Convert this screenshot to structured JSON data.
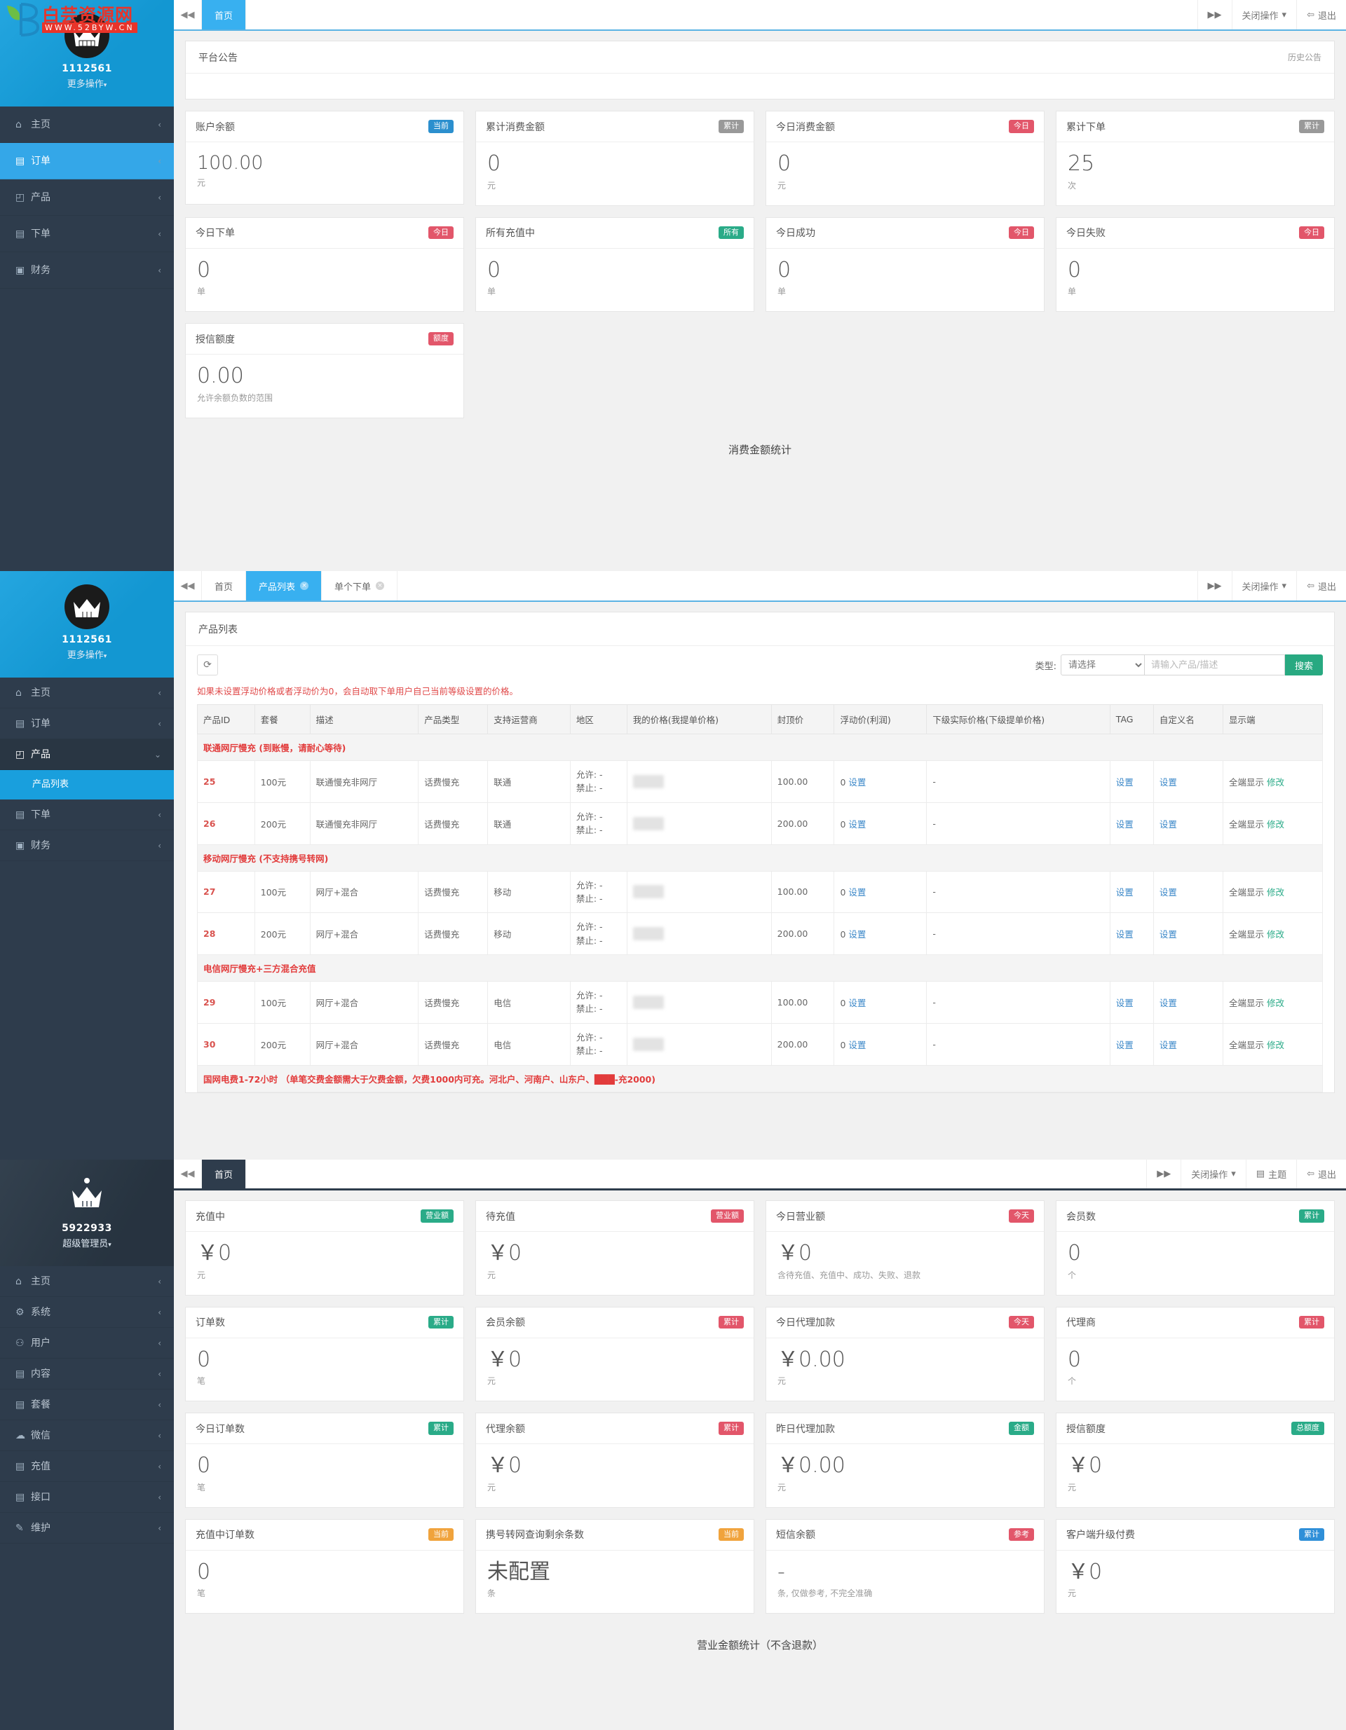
{
  "panel1": {
    "topbar": {
      "collapse_icon": "chevron-double-left-icon",
      "expand_icon": "chevron-double-right-icon",
      "tabs": [
        {
          "label": "首页",
          "active": true,
          "closable": false
        }
      ],
      "actions": [
        {
          "label": "关闭操作",
          "icon": "caret-down-icon"
        },
        {
          "label": "退出",
          "icon": "logout-icon"
        }
      ]
    },
    "sidebar": {
      "user": "1112561",
      "role": "更多操作",
      "avatar_icon": "crown-avatar-icon",
      "items": [
        {
          "label": "主页",
          "icon": "home-icon",
          "active": false
        },
        {
          "label": "订单",
          "icon": "file-icon",
          "active": true
        },
        {
          "label": "产品",
          "icon": "box-icon",
          "active": false
        },
        {
          "label": "下单",
          "icon": "file-icon",
          "active": false
        },
        {
          "label": "财务",
          "icon": "money-icon",
          "active": false
        }
      ]
    },
    "notice": {
      "title": "平台公告",
      "history_link": "历史公告"
    },
    "cards": [
      {
        "title": "账户余额",
        "badge": "当前",
        "badge_color": "blue",
        "value": "100.00",
        "unit": "元"
      },
      {
        "title": "累计消费金额",
        "badge": "累计",
        "badge_color": "gray",
        "value": "0",
        "unit": "元"
      },
      {
        "title": "今日消费金额",
        "badge": "今日",
        "badge_color": "red",
        "value": "0",
        "unit": "元"
      },
      {
        "title": "累计下单",
        "badge": "累计",
        "badge_color": "gray",
        "value": "25",
        "unit": "次"
      },
      {
        "title": "今日下单",
        "badge": "今日",
        "badge_color": "red",
        "value": "0",
        "unit": "单"
      },
      {
        "title": "所有充值中",
        "badge": "所有",
        "badge_color": "green",
        "value": "0",
        "unit": "单"
      },
      {
        "title": "今日成功",
        "badge": "今日",
        "badge_color": "red",
        "value": "0",
        "unit": "单"
      },
      {
        "title": "今日失败",
        "badge": "今日",
        "badge_color": "red",
        "value": "0",
        "unit": "单"
      },
      {
        "title": "授信额度",
        "badge": "额度",
        "badge_color": "red",
        "value": "0.00",
        "unit": "允许余额负数的范围"
      }
    ],
    "chart_title": "消费金额统计"
  },
  "panel2": {
    "topbar": {
      "tabs": [
        {
          "label": "首页",
          "active": false,
          "closable": false
        },
        {
          "label": "产品列表",
          "active": true,
          "closable": true
        },
        {
          "label": "单个下单",
          "active": false,
          "closable": true
        }
      ],
      "actions": [
        {
          "label": "关闭操作",
          "icon": "caret-down-icon"
        },
        {
          "label": "退出",
          "icon": "logout-icon"
        }
      ]
    },
    "sidebar": {
      "user": "1112561",
      "role": "更多操作",
      "avatar_icon": "crown-avatar-icon",
      "items": [
        {
          "label": "主页",
          "icon": "home-icon",
          "active": false
        },
        {
          "label": "订单",
          "icon": "file-icon",
          "active": false
        },
        {
          "label": "产品",
          "icon": "box-icon",
          "active": true,
          "expanded": true
        },
        {
          "label": "下单",
          "icon": "file-icon",
          "active": false
        },
        {
          "label": "财务",
          "icon": "money-icon",
          "active": false
        }
      ],
      "sub_item": "产品列表"
    },
    "panel_title": "产品列表",
    "toolbar": {
      "refresh_icon": "refresh-icon",
      "type_label": "类型:",
      "type_value": "请选择",
      "search_placeholder": "请输入产品/描述",
      "search_button": "搜索"
    },
    "warning": "如果未设置浮动价格或者浮动价为0，会自动取下单用户自己当前等级设置的价格。",
    "table": {
      "headers": [
        "产品ID",
        "套餐",
        "描述",
        "产品类型",
        "支持运营商",
        "地区",
        "我的价格(我提单价格)",
        "封顶价",
        "浮动价(利润)",
        "下级实际价格(下级提单价格)",
        "TAG",
        "自定义名",
        "显示端"
      ],
      "rows": [
        {
          "type": "group",
          "label": "联通网厅慢充 (到账慢，请耐心等待)"
        },
        {
          "type": "row",
          "id": "25",
          "pkg": "100元",
          "desc": "联通慢充非网厅",
          "ptype": "话费慢充",
          "carrier": "联通",
          "region_allow": "允许: -",
          "region_deny": "禁止: -",
          "myprice": "",
          "cap": "100.00",
          "float": "0",
          "float_link": "设置",
          "lower": "-",
          "tag": "设置",
          "custom": "设置",
          "display": "全端显示",
          "edit": "修改"
        },
        {
          "type": "row",
          "id": "26",
          "pkg": "200元",
          "desc": "联通慢充非网厅",
          "ptype": "话费慢充",
          "carrier": "联通",
          "region_allow": "允许: -",
          "region_deny": "禁止: -",
          "myprice": "",
          "cap": "200.00",
          "float": "0",
          "float_link": "设置",
          "lower": "-",
          "tag": "设置",
          "custom": "设置",
          "display": "全端显示",
          "edit": "修改"
        },
        {
          "type": "group",
          "label": "移动网厅慢充 (不支持携号转网)"
        },
        {
          "type": "row",
          "id": "27",
          "pkg": "100元",
          "desc": "网厅+混合",
          "ptype": "话费慢充",
          "carrier": "移动",
          "region_allow": "允许: -",
          "region_deny": "禁止: -",
          "myprice": "",
          "cap": "100.00",
          "float": "0",
          "float_link": "设置",
          "lower": "-",
          "tag": "设置",
          "custom": "设置",
          "display": "全端显示",
          "edit": "修改"
        },
        {
          "type": "row",
          "id": "28",
          "pkg": "200元",
          "desc": "网厅+混合",
          "ptype": "话费慢充",
          "carrier": "移动",
          "region_allow": "允许: -",
          "region_deny": "禁止: -",
          "myprice": "",
          "cap": "200.00",
          "float": "0",
          "float_link": "设置",
          "lower": "-",
          "tag": "设置",
          "custom": "设置",
          "display": "全端显示",
          "edit": "修改"
        },
        {
          "type": "group",
          "label": "电信网厅慢充+三方混合充值"
        },
        {
          "type": "row",
          "id": "29",
          "pkg": "100元",
          "desc": "网厅+混合",
          "ptype": "话费慢充",
          "carrier": "电信",
          "region_allow": "允许: -",
          "region_deny": "禁止: -",
          "myprice": "",
          "cap": "100.00",
          "float": "0",
          "float_link": "设置",
          "lower": "-",
          "tag": "设置",
          "custom": "设置",
          "display": "全端显示",
          "edit": "修改"
        },
        {
          "type": "row",
          "id": "30",
          "pkg": "200元",
          "desc": "网厅+混合",
          "ptype": "话费慢充",
          "carrier": "电信",
          "region_allow": "允许: -",
          "region_deny": "禁止: -",
          "myprice": "",
          "cap": "200.00",
          "float": "0",
          "float_link": "设置",
          "lower": "-",
          "tag": "设置",
          "custom": "设置",
          "display": "全端显示",
          "edit": "修改"
        },
        {
          "type": "group",
          "label": "国网电费1-72小时 （单笔交费金额需大于欠费金额，欠费1000内可充。河北户、河南户、山东户、███-充2000)"
        }
      ]
    }
  },
  "panel3": {
    "topbar": {
      "tabs": [
        {
          "label": "首页",
          "active": true,
          "closable": false
        }
      ],
      "actions": [
        {
          "label": "关闭操作",
          "icon": "caret-down-icon"
        },
        {
          "label": "主题",
          "icon": "theme-icon"
        },
        {
          "label": "退出",
          "icon": "logout-icon"
        }
      ]
    },
    "sidebar": {
      "user": "5922933",
      "role": "超级管理员",
      "avatar_icon": "crown-avatar-icon",
      "items": [
        {
          "label": "主页",
          "icon": "home-icon"
        },
        {
          "label": "系统",
          "icon": "gear-icon"
        },
        {
          "label": "用户",
          "icon": "users-icon"
        },
        {
          "label": "内容",
          "icon": "file-icon"
        },
        {
          "label": "套餐",
          "icon": "file-icon"
        },
        {
          "label": "微信",
          "icon": "wechat-icon"
        },
        {
          "label": "充值",
          "icon": "file-icon"
        },
        {
          "label": "接口",
          "icon": "file-icon"
        },
        {
          "label": "维护",
          "icon": "wrench-icon"
        }
      ]
    },
    "cards": [
      {
        "title": "充值中",
        "badge": "营业额",
        "badge_color": "green",
        "value": "￥0",
        "unit": "元"
      },
      {
        "title": "待充值",
        "badge": "营业额",
        "badge_color": "red",
        "value": "￥0",
        "unit": "元"
      },
      {
        "title": "今日营业额",
        "badge": "今天",
        "badge_color": "red",
        "value": "￥0",
        "unit": "含待充值、充值中、成功、失败、退款"
      },
      {
        "title": "会员数",
        "badge": "累计",
        "badge_color": "green",
        "value": "0",
        "unit": "个"
      },
      {
        "title": "订单数",
        "badge": "累计",
        "badge_color": "green",
        "value": "0",
        "unit": "笔"
      },
      {
        "title": "会员余额",
        "badge": "累计",
        "badge_color": "red",
        "value": "￥0",
        "unit": "元"
      },
      {
        "title": "今日代理加款",
        "badge": "今天",
        "badge_color": "red",
        "value": "￥0.00",
        "unit": "元"
      },
      {
        "title": "代理商",
        "badge": "累计",
        "badge_color": "red",
        "value": "0",
        "unit": "个"
      },
      {
        "title": "今日订单数",
        "badge": "累计",
        "badge_color": "green",
        "value": "0",
        "unit": "笔"
      },
      {
        "title": "代理余额",
        "badge": "累计",
        "badge_color": "red",
        "value": "￥0",
        "unit": "元"
      },
      {
        "title": "昨日代理加款",
        "badge": "金额",
        "badge_color": "green",
        "value": "￥0.00",
        "unit": "元"
      },
      {
        "title": "授信额度",
        "badge": "总额度",
        "badge_color": "green",
        "value": "￥0",
        "unit": "元"
      },
      {
        "title": "充值中订单数",
        "badge": "当前",
        "badge_color": "orange",
        "value": "0",
        "unit": "笔"
      },
      {
        "title": "携号转网查询剩余条数",
        "badge": "当前",
        "badge_color": "orange",
        "value": "未配置",
        "unit": "条"
      },
      {
        "title": "短信余额",
        "badge": "参考",
        "badge_color": "red",
        "value": "-",
        "unit": "条, 仅做参考, 不完全准确"
      },
      {
        "title": "客户端升级付费",
        "badge": "累计",
        "badge_color": "lblue",
        "value": "￥0",
        "unit": "元"
      }
    ],
    "chart_title": "营业金额统计（不含退款）"
  },
  "watermark": {
    "text": "白芸资源网",
    "url": "WWW.52BYW.CN"
  }
}
